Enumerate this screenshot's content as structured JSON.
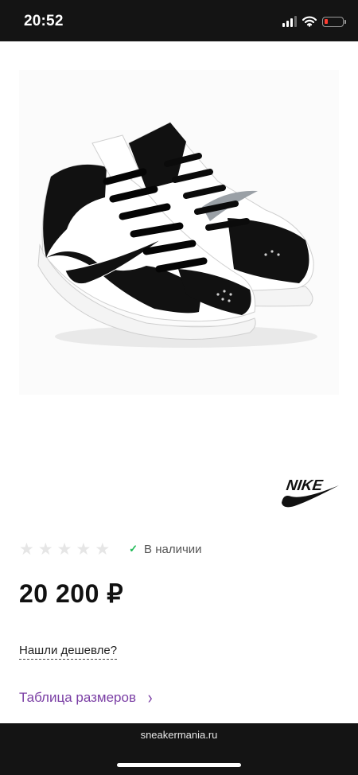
{
  "status_bar": {
    "time": "20:52",
    "battery_level": 0.2
  },
  "product": {
    "brand": "NIKE",
    "rating": 0,
    "max_rating": 5,
    "availability": "В наличии",
    "price": "20 200 ₽",
    "cheaper_link": "Нашли дешевле?",
    "size_table_link": "Таблица размеров"
  },
  "browser": {
    "url": "sneakermania.ru"
  },
  "colors": {
    "accent": "#7b3fa5",
    "in_stock": "#1db954",
    "star_empty": "#e6e6e6",
    "bar_bg": "#141414",
    "battery_low": "#ff3b30"
  }
}
